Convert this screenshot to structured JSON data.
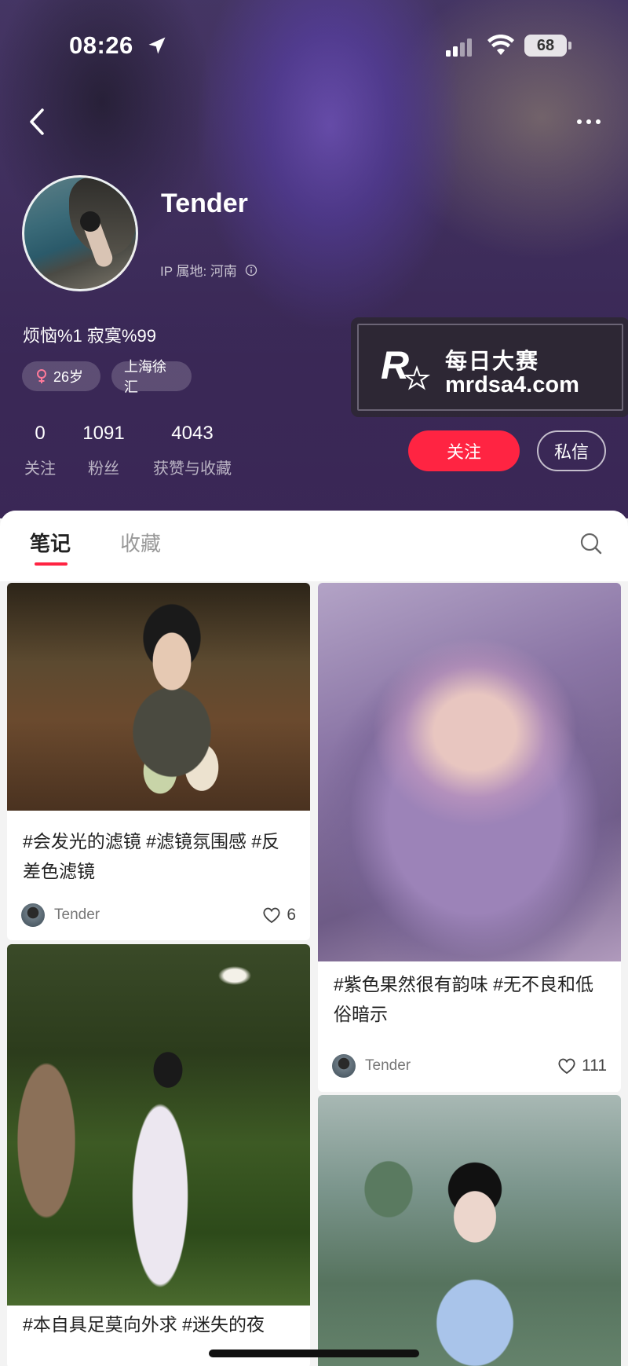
{
  "status_bar": {
    "time": "08:26",
    "battery": "68"
  },
  "profile": {
    "name": "Tender",
    "ip_location": "IP 属地: 河南",
    "bio": "烦恼%1  寂寞%99",
    "tags": {
      "age": "26岁",
      "location": "上海徐汇"
    },
    "stats": [
      {
        "value": "0",
        "label": "关注"
      },
      {
        "value": "1091",
        "label": "粉丝"
      },
      {
        "value": "4043",
        "label": "获赞与收藏"
      }
    ],
    "follow_label": "关注",
    "message_label": "私信"
  },
  "watermark": {
    "cn": "每日大赛",
    "url": "mrdsa4.com",
    "logo_text": "R"
  },
  "tabs": [
    {
      "label": "笔记",
      "active": true
    },
    {
      "label": "收藏",
      "active": false
    }
  ],
  "notes": [
    {
      "title": "#会发光的滤镜 #滤镜氛围感 #反差色滤镜",
      "author": "Tender",
      "likes": "6"
    },
    {
      "title": "#紫色果然很有韵味 #无不良和低俗暗示",
      "author": "Tender",
      "likes": "111"
    },
    {
      "title": "#本自具足莫向外求 #迷失的夜",
      "author": "",
      "likes": ""
    },
    {
      "title": "",
      "author": "",
      "likes": ""
    }
  ],
  "colors": {
    "accent": "#ff2442",
    "header_purple": "#4a3868"
  }
}
